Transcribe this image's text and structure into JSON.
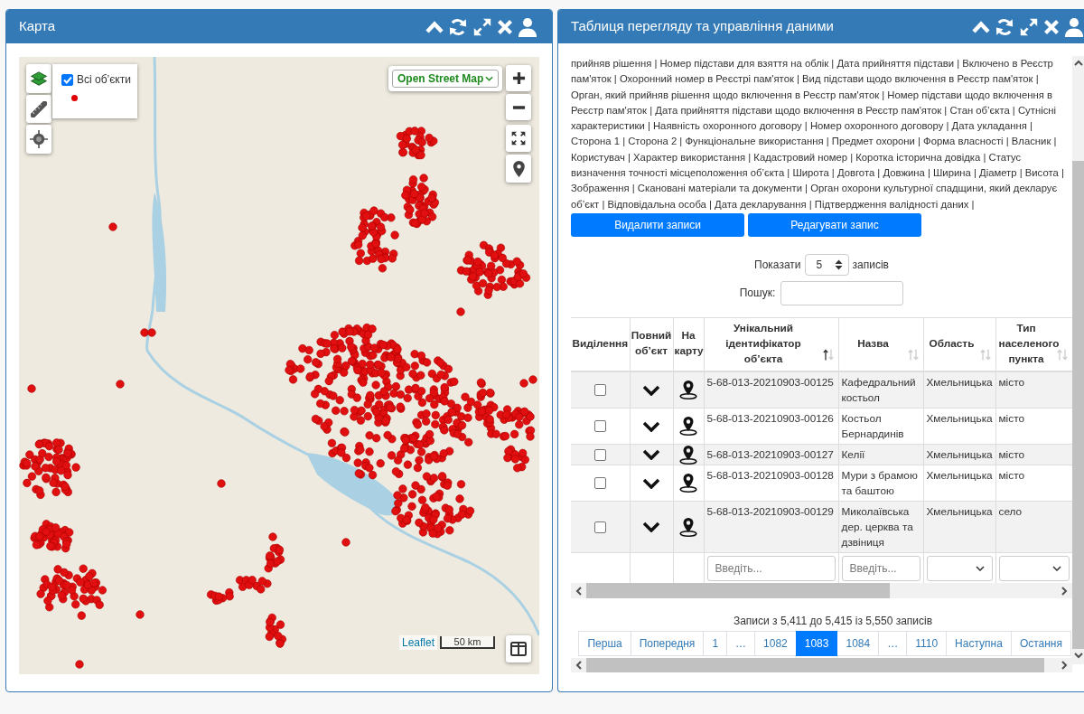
{
  "map_panel": {
    "title": "Карта",
    "basemap": {
      "value": "Open Street Map"
    },
    "layers": [
      {
        "label": "Всі об’єкти",
        "checked": true
      }
    ],
    "attribution": "Leaflet",
    "scale": "50 km"
  },
  "table_panel": {
    "title": "Таблиця перегляду та управління даними",
    "column_list": "прийняв рішення | Номер підстави для взяття на облік | Дата прийняття підстави | Включено в Реєстр пам'яток | Охоронний номер в Реєстрі пам'яток | Вид підстави щодо включення в Реєстр пам'яток | Орган, який прийняв рішення щодо включення в Реєстр пам'яток | Номер підстави щодо включення в Реєстр пам'яток | Дата прийняття підстави щодо включення в Реєстр пам'яток | Стан об’єкта | Сутнісні характеристики | Наявність охоронного договору | Номер охоронного договору | Дата укладання | Сторона 1 | Сторона 2 | Функціональне використання | Предмет охорони | Форма власності | Власник | Користувач | Характер використання | Кадастровий номер | Коротка історична довідка | Статус визначення точності місцеположення об’єкта | Широта | Довгота | Довжина | Ширина | Діаметр | Висота | Зображення | Скановані матеріали та документи | Орган охорони культурної спадщини, який декларує об’єкт | Відповідальна особа | Дата декларування | Підтвердження валідності даних |",
    "buttons": [
      {
        "label": "Видалити записи"
      },
      {
        "label": "Редагувати запис"
      }
    ],
    "page_size": {
      "label": "Показати",
      "value": "5",
      "suffix": "записів"
    },
    "search": {
      "label": "Пошук:"
    },
    "table": {
      "columns": [
        {
          "label": "Виділення",
          "sortable": false
        },
        {
          "label": "Повний об’єкт",
          "sortable": false
        },
        {
          "label": "На карту",
          "sortable": false
        },
        {
          "label": "Унікальний ідентифікатор об’єкта",
          "sortable": true,
          "sorted": true
        },
        {
          "label": "Назва",
          "sortable": true,
          "sorted": false
        },
        {
          "label": "Область",
          "sortable": true,
          "sorted": false
        },
        {
          "label": "Тип населеного пункта",
          "sortable": true,
          "sorted": false
        }
      ],
      "rows": [
        {
          "checked": false,
          "id": "5-68-013-20210903-00125",
          "name": "Кафедральний костьол",
          "region": "Хмельницька",
          "settlement_type": "місто"
        },
        {
          "checked": false,
          "id": "5-68-013-20210903-00126",
          "name": "Костьол Бернардинів",
          "region": "Хмельницька",
          "settlement_type": "місто"
        },
        {
          "checked": false,
          "id": "5-68-013-20210903-00127",
          "name": "Келії",
          "region": "Хмельницька",
          "settlement_type": "місто"
        },
        {
          "checked": false,
          "id": "5-68-013-20210903-00128",
          "name": "Мури з брамою та баштою",
          "region": "Хмельницька",
          "settlement_type": "місто"
        },
        {
          "checked": false,
          "id": "5-68-013-20210903-00129",
          "name": "Миколаївська дер. церква та дзвіниця",
          "region": "Хмельницька",
          "settlement_type": "село"
        }
      ],
      "filters": [
        {
          "kind": "blank"
        },
        {
          "kind": "blank"
        },
        {
          "kind": "blank"
        },
        {
          "kind": "text",
          "placeholder": "Введіть..."
        },
        {
          "kind": "text",
          "placeholder": "Введіть..."
        },
        {
          "kind": "select"
        },
        {
          "kind": "select"
        }
      ]
    },
    "info": "Записи з 5,411 до 5,415 із 5,550 записів",
    "pagination": [
      {
        "label": "Перша",
        "selected": false
      },
      {
        "label": "Попередня",
        "selected": false
      },
      {
        "label": "1",
        "selected": false
      },
      {
        "label": "…",
        "selected": false
      },
      {
        "label": "1082",
        "selected": false
      },
      {
        "label": "1083",
        "selected": true
      },
      {
        "label": "1084",
        "selected": false
      },
      {
        "label": "…",
        "selected": false
      },
      {
        "label": "1110",
        "selected": false
      },
      {
        "label": "Наступна",
        "selected": false
      },
      {
        "label": "Остання",
        "selected": false
      }
    ]
  }
}
